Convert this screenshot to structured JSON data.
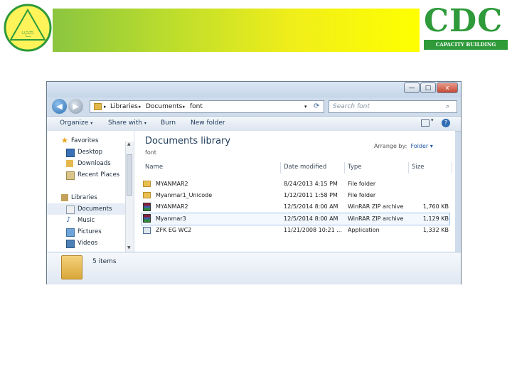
{
  "colors": {
    "accent_green": "#2e9a3a",
    "header_left": "#8bc53f",
    "header_right": "#ffff00"
  },
  "logo_left": {
    "text": "ပညာ"
  },
  "cdc_logo": {
    "letters": "CDC",
    "tagline": "CAPACITY BUILDING CENTER"
  },
  "explorer": {
    "window_buttons": {
      "minimize": "—",
      "maximize": "□",
      "close": "x"
    },
    "nav": {
      "back": "◀",
      "forward": "▶"
    },
    "address_crumbs": [
      "Libraries",
      "Documents",
      "font"
    ],
    "search_placeholder": "Search font",
    "toolbar": {
      "organize": "Organize",
      "share_with": "Share with",
      "burn": "Burn",
      "new_folder": "New folder"
    },
    "sidebar": {
      "favorites": "Favorites",
      "favorites_items": [
        "Desktop",
        "Downloads",
        "Recent Places"
      ],
      "libraries": "Libraries",
      "libraries_items": [
        "Documents",
        "Music",
        "Pictures",
        "Videos"
      ]
    },
    "library": {
      "title": "Documents library",
      "subtitle": "font",
      "arrange_by_label": "Arrange by:",
      "arrange_by_value": "Folder"
    },
    "columns": [
      "Name",
      "Date modified",
      "Type",
      "Size"
    ],
    "files": [
      {
        "name": "MYANMAR2",
        "date": "8/24/2013 4:15 PM",
        "type": "File folder",
        "size": "",
        "icon": "folder-icon"
      },
      {
        "name": "Myanmar1_Unicode",
        "date": "1/12/2011 1:58 PM",
        "type": "File folder",
        "size": "",
        "icon": "folder-icon"
      },
      {
        "name": "MYANMAR2",
        "date": "12/5/2014 8:00 AM",
        "type": "WinRAR ZIP archive",
        "size": "1,760 KB",
        "icon": "winrar-icon"
      },
      {
        "name": "Myanmar3",
        "date": "12/5/2014 8:00 AM",
        "type": "WinRAR ZIP archive",
        "size": "1,129 KB",
        "icon": "winrar-icon"
      },
      {
        "name": "ZFK EG WC2",
        "date": "11/21/2008 10:21 ...",
        "type": "Application",
        "size": "1,332 KB",
        "icon": "application-icon"
      }
    ],
    "status_text": "5 items"
  }
}
